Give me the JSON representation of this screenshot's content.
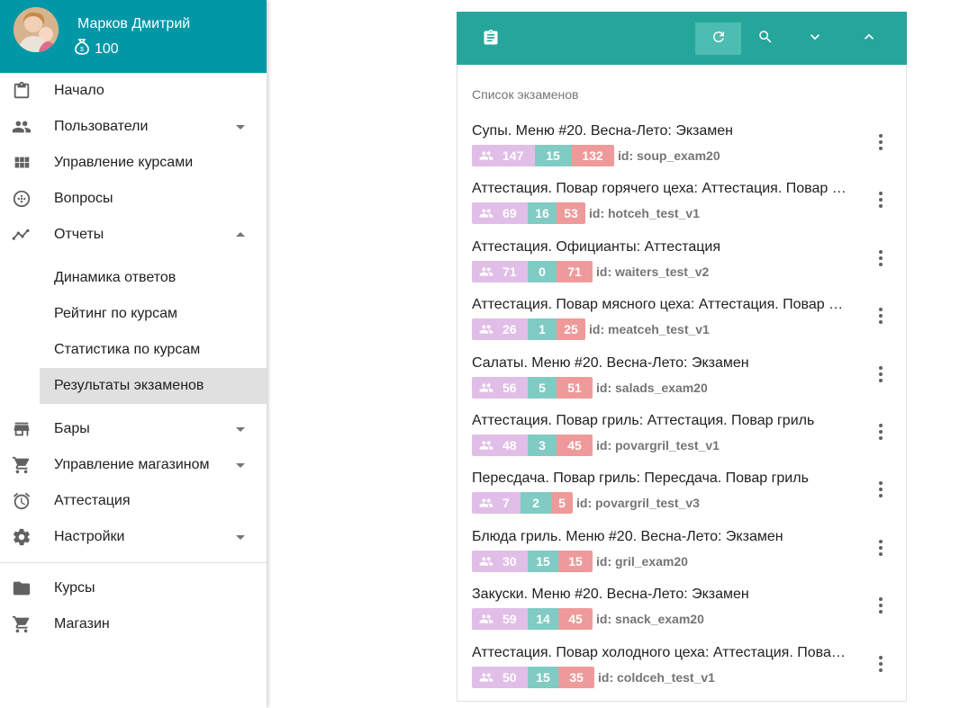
{
  "colors": {
    "profile_bg": "#0097a7",
    "toolbar_bg": "#26a69a",
    "users_badge": "#e1bee7",
    "passed_badge": "#80cbc4",
    "failed_badge": "#ef9a9a",
    "active_item_bg": "#e0e0e0"
  },
  "profile": {
    "name": "Марков Дмитрий",
    "coins": "100"
  },
  "sidebar": {
    "items": [
      {
        "label": "Начало",
        "icon": "clipboard-icon"
      },
      {
        "label": "Пользователи",
        "icon": "people-icon",
        "arrow": "down"
      },
      {
        "label": "Управление курсами",
        "icon": "grid-icon"
      },
      {
        "label": "Вопросы",
        "icon": "dots-circle-icon"
      },
      {
        "label": "Отчеты",
        "icon": "trend-icon",
        "arrow": "up"
      }
    ],
    "subitems": [
      {
        "label": "Динамика ответов"
      },
      {
        "label": "Рейтинг по курсам"
      },
      {
        "label": "Статистика по курсам"
      },
      {
        "label": "Результаты экзаменов",
        "active": true
      }
    ],
    "items2": [
      {
        "label": "Бары",
        "icon": "store-icon",
        "arrow": "down"
      },
      {
        "label": "Управление магазином",
        "icon": "cart-icon",
        "arrow": "down"
      },
      {
        "label": "Аттестация",
        "icon": "alarm-icon"
      },
      {
        "label": "Настройки",
        "icon": "gear-icon",
        "arrow": "down"
      }
    ],
    "items3": [
      {
        "label": "Курсы",
        "icon": "folder-icon"
      },
      {
        "label": "Магазин",
        "icon": "cart-icon"
      }
    ]
  },
  "main": {
    "subheader": "Список экзаменов",
    "exams": [
      {
        "title": "Супы. Меню #20. Весна-Лето: Экзамен",
        "users": "147",
        "passed": "15",
        "failed": "132",
        "id": "id: soup_exam20"
      },
      {
        "title": "Аттестация. Повар горячего цеха: Аттестация. Повар горячего цеха",
        "users": "69",
        "passed": "16",
        "failed": "53",
        "id": "id: hotceh_test_v1"
      },
      {
        "title": "Аттестация. Официанты: Аттестация",
        "users": "71",
        "passed": "0",
        "failed": "71",
        "id": "id: waiters_test_v2"
      },
      {
        "title": "Аттестация. Повар мясного цеха: Аттестация. Повар мясного цеха",
        "users": "26",
        "passed": "1",
        "failed": "25",
        "id": "id: meatceh_test_v1"
      },
      {
        "title": "Салаты. Меню #20. Весна-Лето: Экзамен",
        "users": "56",
        "passed": "5",
        "failed": "51",
        "id": "id: salads_exam20"
      },
      {
        "title": "Аттестация. Повар гриль: Аттестация. Повар гриль",
        "users": "48",
        "passed": "3",
        "failed": "45",
        "id": "id: povargril_test_v1"
      },
      {
        "title": "Пересдача. Повар гриль: Пересдача. Повар гриль",
        "users": "7",
        "passed": "2",
        "failed": "5",
        "id": "id: povargril_test_v3"
      },
      {
        "title": "Блюда гриль. Меню #20. Весна-Лето: Экзамен",
        "users": "30",
        "passed": "15",
        "failed": "15",
        "id": "id: gril_exam20"
      },
      {
        "title": "Закуски. Меню #20. Весна-Лето: Экзамен",
        "users": "59",
        "passed": "14",
        "failed": "45",
        "id": "id: snack_exam20"
      },
      {
        "title": "Аттестация. Повар холодного цеха: Аттестация. Повар холодного цеха",
        "users": "50",
        "passed": "15",
        "failed": "35",
        "id": "id: coldceh_test_v1"
      }
    ]
  }
}
